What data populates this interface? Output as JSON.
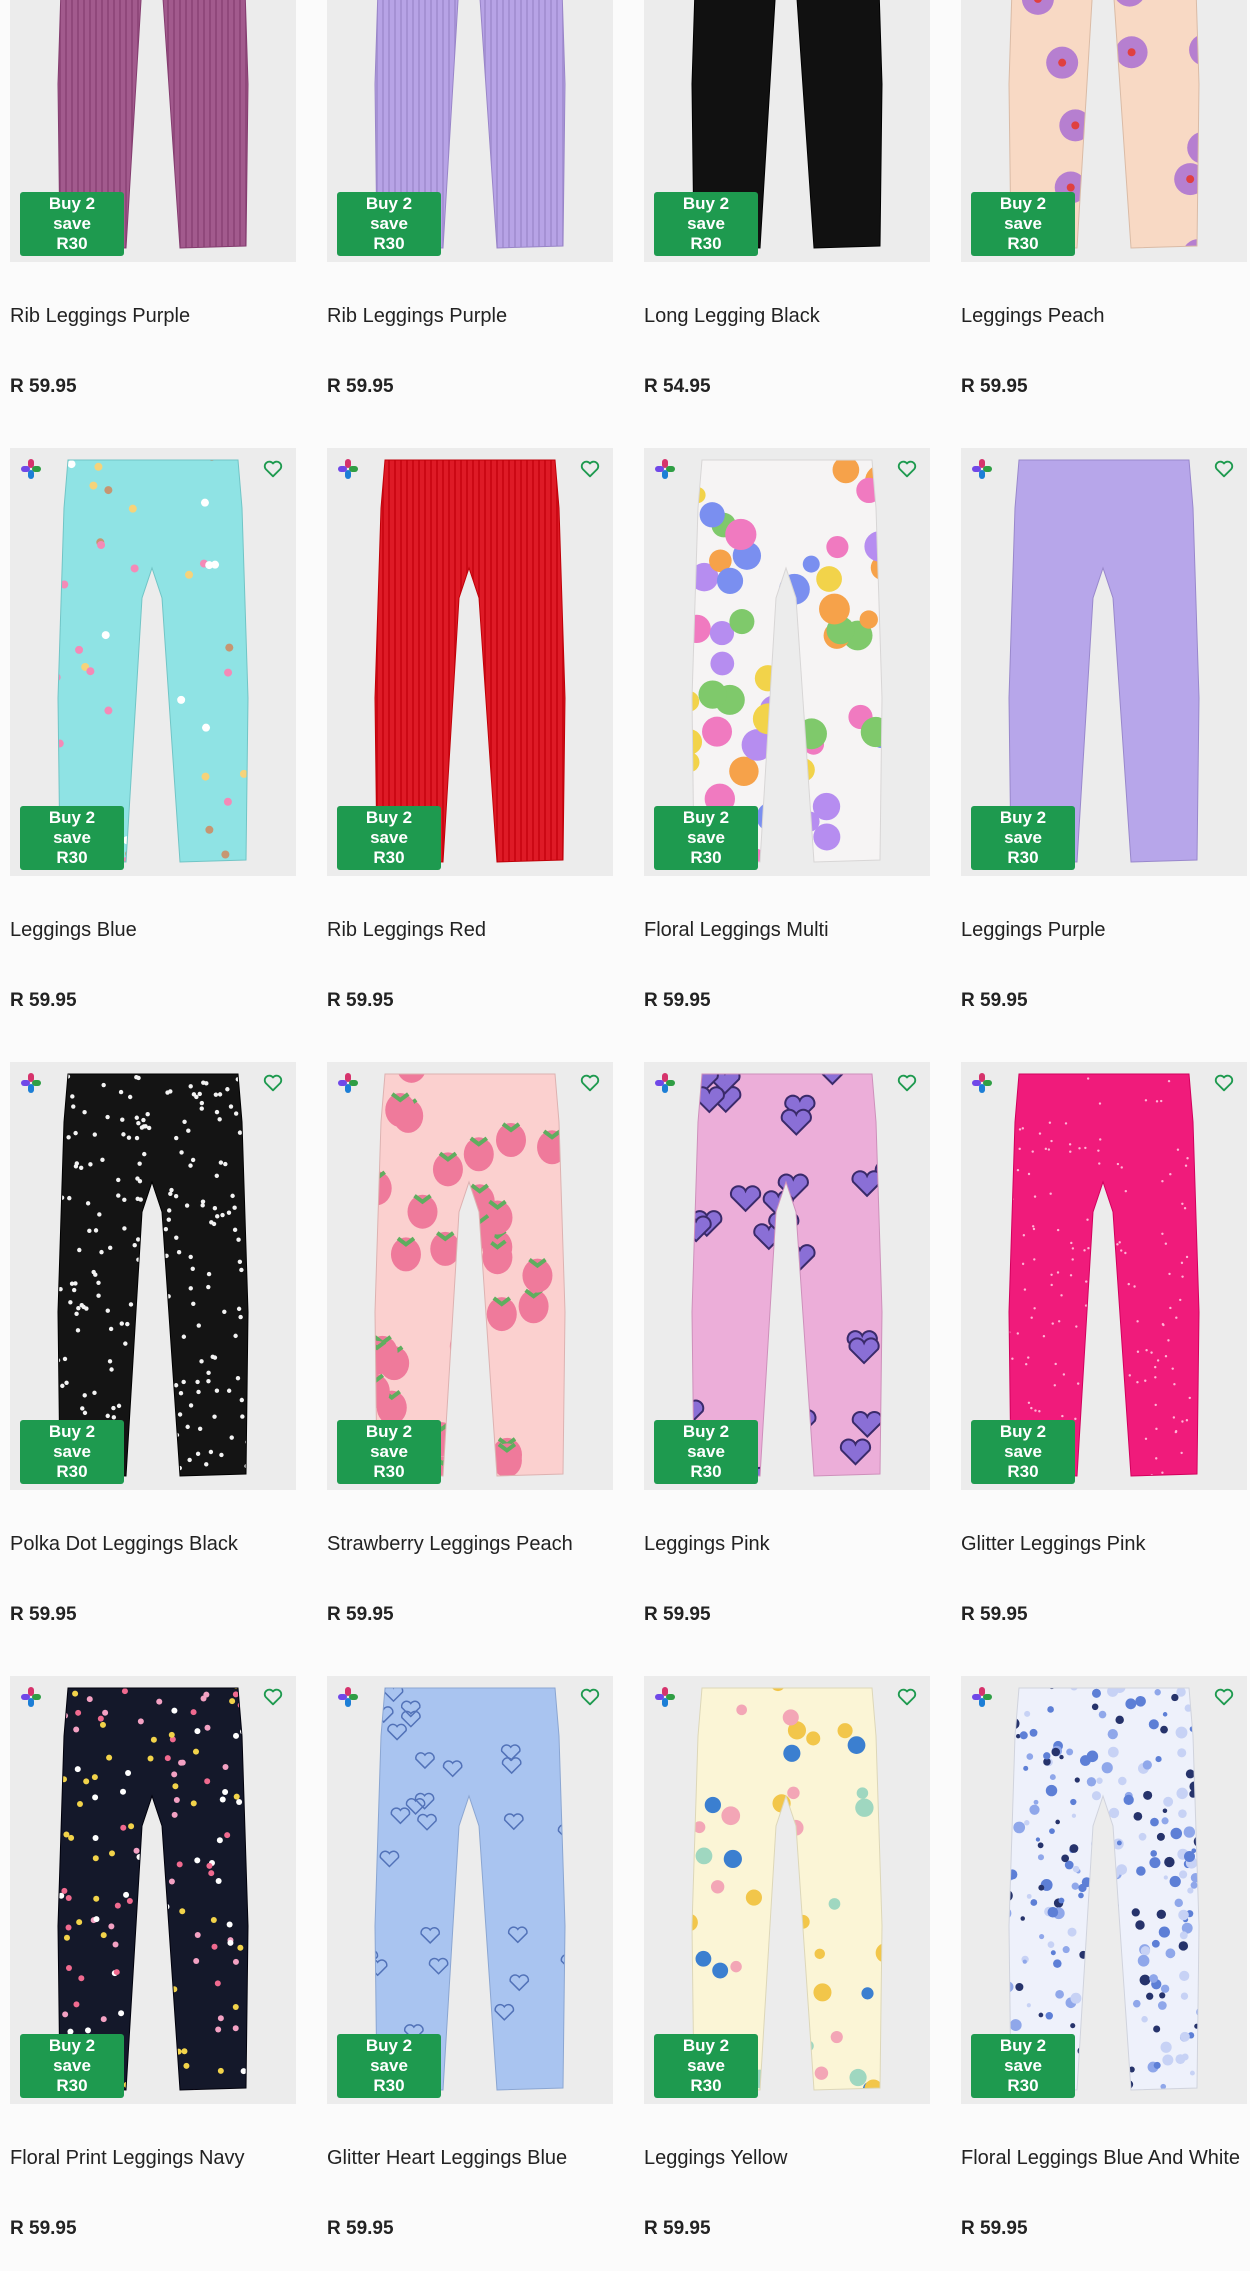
{
  "products": [
    {
      "name": "Rib Leggings Purple",
      "price": "R 59.95",
      "badge": [
        "Buy 2 save",
        "R30"
      ],
      "color": "#a25a8d",
      "pattern": "rib"
    },
    {
      "name": "Rib Leggings Purple",
      "price": "R 59.95",
      "badge": [
        "Buy 2 save",
        "R30"
      ],
      "color": "#b7a3e6",
      "pattern": "rib"
    },
    {
      "name": "Long Legging Black",
      "price": "R 54.95",
      "badge": [
        "Buy 2 save",
        "R30"
      ],
      "color": "#111111",
      "pattern": "plain"
    },
    {
      "name": "Leggings Peach",
      "price": "R 59.95",
      "badge": [
        "Buy 2 save",
        "R30"
      ],
      "color": "#f8d9c4",
      "pattern": "flowers-purple"
    },
    {
      "name": "Leggings Blue",
      "price": "R 59.95",
      "badge": [
        "Buy 2 save",
        "R30"
      ],
      "color": "#8fe3e4",
      "pattern": "icecream"
    },
    {
      "name": "Rib Leggings Red",
      "price": "R 59.95",
      "badge": [
        "Buy 2 save",
        "R30"
      ],
      "color": "#de1a26",
      "pattern": "rib"
    },
    {
      "name": "Floral Leggings Multi",
      "price": "R 59.95",
      "badge": [
        "Buy 2 save",
        "R30"
      ],
      "color": "#f6f4f4",
      "pattern": "flowers-multi"
    },
    {
      "name": "Leggings Purple",
      "price": "R 59.95",
      "badge": [
        "Buy 2 save",
        "R30"
      ],
      "color": "#b7a6ea",
      "pattern": "plain"
    },
    {
      "name": "Polka Dot Leggings Black",
      "price": "R 59.95",
      "badge": [
        "Buy 2 save",
        "R30"
      ],
      "color": "#141414",
      "pattern": "dots-white"
    },
    {
      "name": "Strawberry Leggings Peach",
      "price": "R 59.95",
      "badge": [
        "Buy 2 save",
        "R30"
      ],
      "color": "#fbd0cf",
      "pattern": "strawberry"
    },
    {
      "name": "Leggings Pink",
      "price": "R 59.95",
      "badge": [
        "Buy 2 save",
        "R30"
      ],
      "color": "#ecaed9",
      "pattern": "hearts-purple"
    },
    {
      "name": "Glitter Leggings Pink",
      "price": "R 59.95",
      "badge": [
        "Buy 2 save",
        "R30"
      ],
      "color": "#f01b7b",
      "pattern": "glitter"
    },
    {
      "name": "Floral Print Leggings Navy",
      "price": "R 59.95",
      "badge": [
        "Buy 2 save",
        "R30"
      ],
      "color": "#14182a",
      "pattern": "flowers-small"
    },
    {
      "name": "Glitter Heart Leggings Blue",
      "price": "R 59.95",
      "badge": [
        "Buy 2 save",
        "R30"
      ],
      "color": "#a9c4f0",
      "pattern": "hearts-outline"
    },
    {
      "name": "Leggings Yellow",
      "price": "R 59.95",
      "badge": [
        "Buy 2 save",
        "R30"
      ],
      "color": "#fbf5d6",
      "pattern": "birds"
    },
    {
      "name": "Floral Leggings Blue And White",
      "price": "R 59.95",
      "badge": [
        "Buy 2 save",
        "R30"
      ],
      "color": "#eef1fb",
      "pattern": "flowers-blue"
    }
  ],
  "icons": {
    "compare": "compare-icon",
    "wishlist": "heart-outline-icon"
  },
  "colors": {
    "badge": "#1e9a4f",
    "heart": "#1e9a4f",
    "imageBg": "#ececec"
  }
}
